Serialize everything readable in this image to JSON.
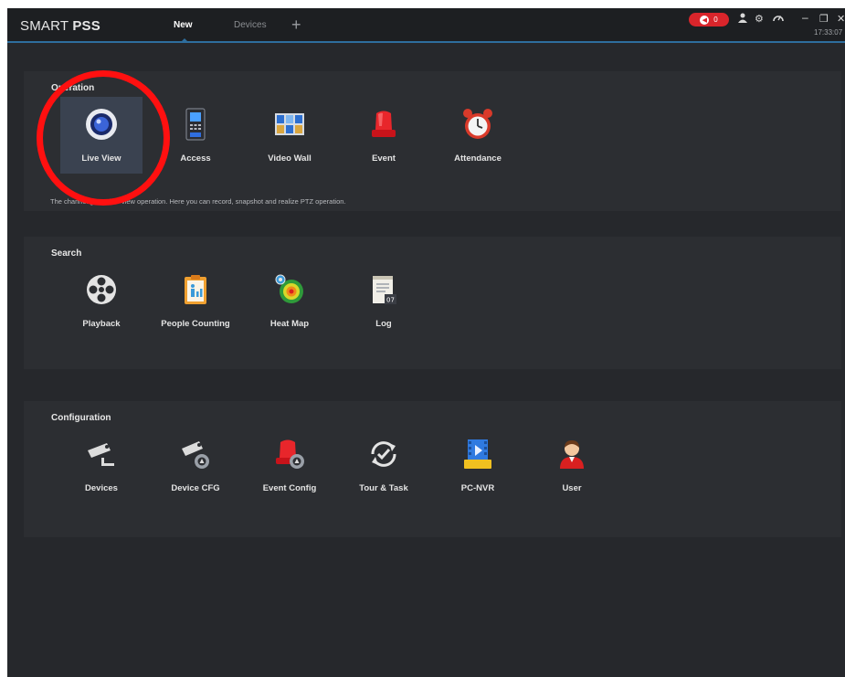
{
  "titlebar": {
    "brand_light": "SMART",
    "brand_bold": "PSS",
    "tabs": [
      {
        "label": "New",
        "active": true
      },
      {
        "label": "Devices",
        "active": false
      }
    ],
    "add_tab_glyph": "+",
    "alarm_count": "0",
    "time": "17:33:07",
    "icons": [
      "alarm-icon",
      "user-icon",
      "gear-icon",
      "speed-icon",
      "minimize-icon",
      "restore-icon",
      "close-icon"
    ]
  },
  "sections": {
    "operation": {
      "title": "Operation",
      "items": [
        {
          "label": "Live View",
          "icon": "live-view-icon",
          "selected": true
        },
        {
          "label": "Access",
          "icon": "access-icon"
        },
        {
          "label": "Video Wall",
          "icon": "video-wall-icon"
        },
        {
          "label": "Event",
          "icon": "event-icon"
        },
        {
          "label": "Attendance",
          "icon": "attendance-icon"
        }
      ],
      "description": "The channel group live view operation. Here you can record, snapshot and realize PTZ operation."
    },
    "search": {
      "title": "Search",
      "items": [
        {
          "label": "Playback",
          "icon": "playback-icon"
        },
        {
          "label": "People Counting",
          "icon": "people-counting-icon"
        },
        {
          "label": "Heat Map",
          "icon": "heat-map-icon"
        },
        {
          "label": "Log",
          "icon": "log-icon"
        }
      ]
    },
    "configuration": {
      "title": "Configuration",
      "items": [
        {
          "label": "Devices",
          "icon": "devices-icon"
        },
        {
          "label": "Device CFG",
          "icon": "device-cfg-icon"
        },
        {
          "label": "Event Config",
          "icon": "event-config-icon"
        },
        {
          "label": "Tour & Task",
          "icon": "tour-task-icon"
        },
        {
          "label": "PC-NVR",
          "icon": "pc-nvr-icon"
        },
        {
          "label": "User",
          "icon": "user-icon"
        }
      ]
    }
  },
  "colors": {
    "background": "#26282c",
    "section": "#2c2e32",
    "accent": "#2e6e9e",
    "alarm": "#d9252b",
    "highlight_ring": "#ff1010"
  }
}
